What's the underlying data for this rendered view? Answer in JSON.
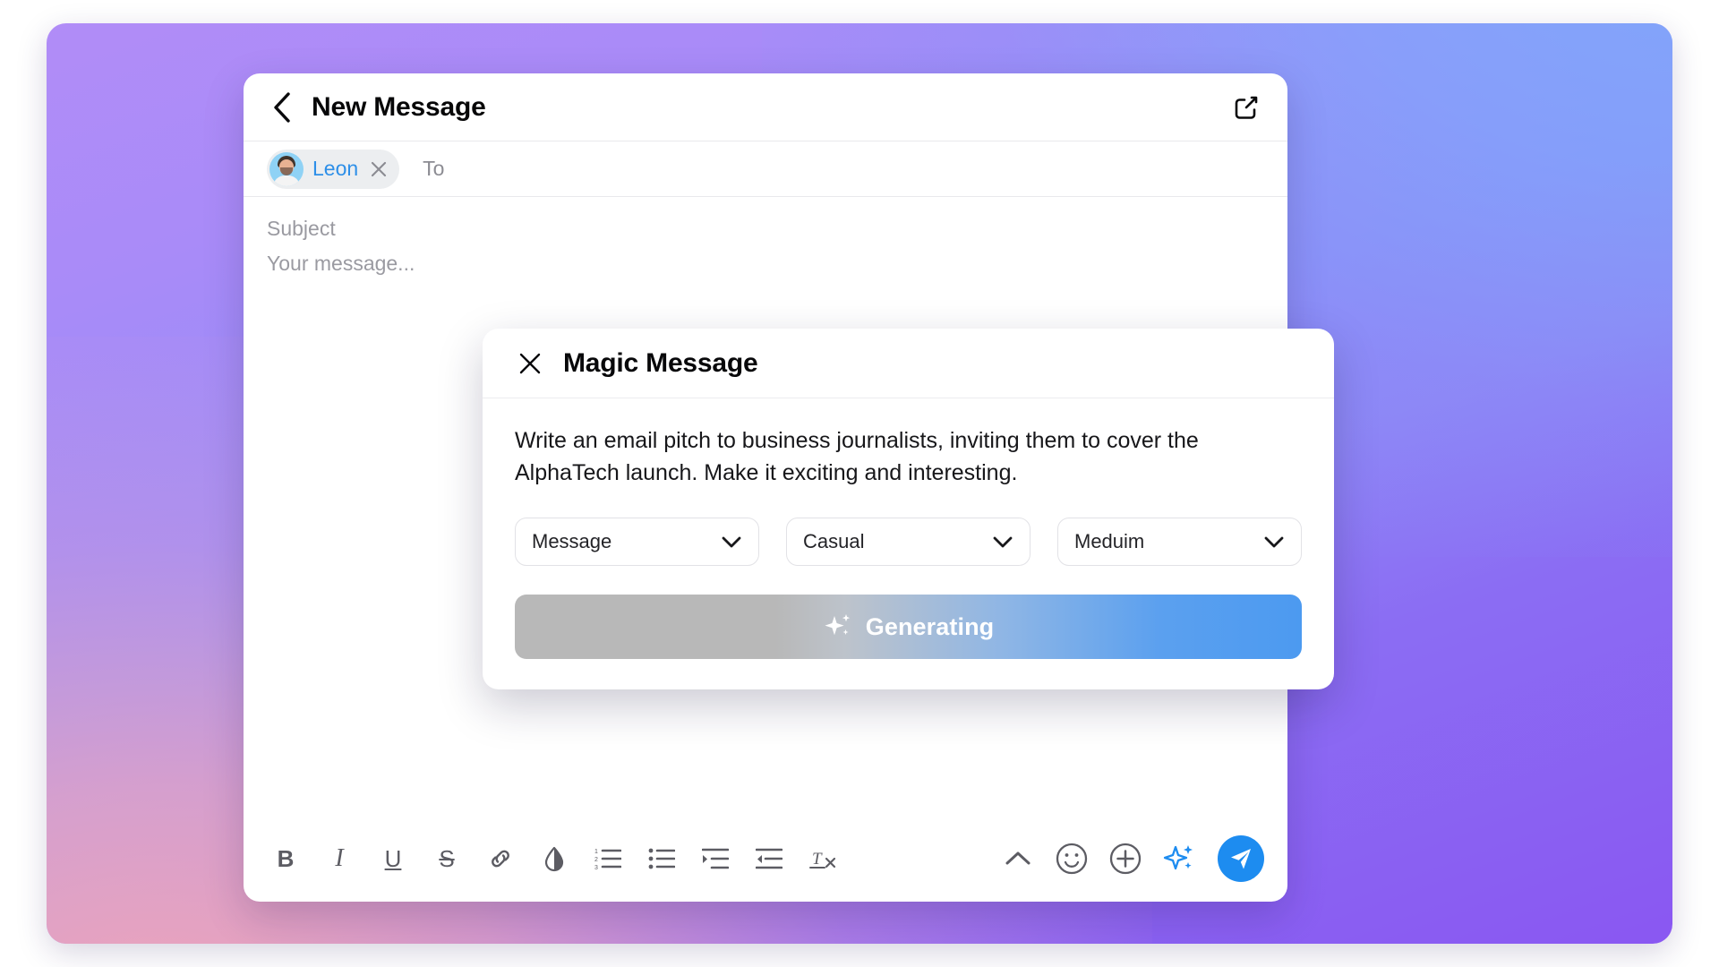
{
  "window": {
    "title": "New Message",
    "back_icon": "chevron-left-icon",
    "expand_icon": "external-link-icon"
  },
  "recipients": {
    "to_placeholder": "To",
    "chips": [
      {
        "name": "Leon",
        "remove_icon": "close-icon",
        "avatar_icon": "avatar"
      }
    ]
  },
  "composer": {
    "subject_placeholder": "Subject",
    "message_placeholder": "Your message..."
  },
  "toolbar": {
    "left": [
      {
        "name": "bold-button",
        "label": "B",
        "icon": "bold-icon"
      },
      {
        "name": "italic-button",
        "label": "I",
        "icon": "italic-icon"
      },
      {
        "name": "underline-button",
        "label": "U",
        "icon": "underline-icon"
      },
      {
        "name": "strikethrough-button",
        "label": "S",
        "icon": "strikethrough-icon"
      },
      {
        "name": "link-button",
        "label": "",
        "icon": "link-icon"
      },
      {
        "name": "highlight-button",
        "label": "",
        "icon": "droplet-icon"
      },
      {
        "name": "numbered-list-button",
        "label": "",
        "icon": "numbered-list-icon"
      },
      {
        "name": "bulleted-list-button",
        "label": "",
        "icon": "bulleted-list-icon"
      },
      {
        "name": "indent-button",
        "label": "",
        "icon": "indent-increase-icon"
      },
      {
        "name": "outdent-button",
        "label": "",
        "icon": "indent-decrease-icon"
      },
      {
        "name": "clear-formatting-button",
        "label": "",
        "icon": "clear-format-icon"
      }
    ],
    "right": [
      {
        "name": "collapse-toolbar-button",
        "icon": "chevron-up-icon"
      },
      {
        "name": "emoji-button",
        "icon": "smiley-icon"
      },
      {
        "name": "attach-button",
        "icon": "plus-circle-icon"
      },
      {
        "name": "magic-sparkle-button",
        "icon": "sparkle-icon"
      },
      {
        "name": "send-button",
        "icon": "paper-plane-icon"
      }
    ]
  },
  "magic_modal": {
    "title": "Magic Message",
    "close_icon": "close-icon",
    "prompt": "Write an email pitch to business journalists, inviting them to cover the AlphaTech launch. Make it exciting and interesting.",
    "selects": [
      {
        "name": "format-select",
        "value": "Message",
        "chevron": "chevron-down-icon"
      },
      {
        "name": "tone-select",
        "value": "Casual",
        "chevron": "chevron-down-icon"
      },
      {
        "name": "length-select",
        "value": "Meduim",
        "chevron": "chevron-down-icon"
      }
    ],
    "action": {
      "label": "Generating",
      "icon": "sparkle-icon",
      "state": "generating"
    }
  },
  "colors": {
    "accent_blue": "#1d8cf0",
    "chip_text": "#2d8fe8",
    "placeholder": "#9a9aa1",
    "bg_gradient_top_left": "#b18cf7",
    "bg_gradient_top_right": "#7ea9fa",
    "bg_gradient_bottom_left": "#f7aab4",
    "bg_gradient_bottom_right": "#8a57f2"
  }
}
